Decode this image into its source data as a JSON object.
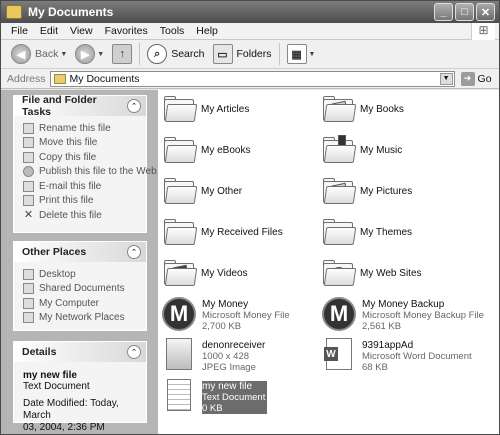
{
  "window": {
    "title": "My Documents"
  },
  "title_buttons": {
    "minimize": "_",
    "maximize": "□",
    "close": "✕"
  },
  "menubar": {
    "items": [
      "File",
      "Edit",
      "View",
      "Favorites",
      "Tools",
      "Help"
    ]
  },
  "toolbar": {
    "back": "Back",
    "search": "Search",
    "folders": "Folders"
  },
  "address": {
    "label": "Address",
    "value": "My Documents",
    "go": "Go"
  },
  "file_tasks": {
    "title": "File and Folder Tasks",
    "items": [
      {
        "label": "Rename this file",
        "icon": "rename-icon"
      },
      {
        "label": "Move this file",
        "icon": "move-icon"
      },
      {
        "label": "Copy this file",
        "icon": "copy-icon"
      },
      {
        "label": "Publish this file to the Web",
        "icon": "globe-icon"
      },
      {
        "label": "E-mail this file",
        "icon": "email-icon"
      },
      {
        "label": "Print this file",
        "icon": "print-icon"
      },
      {
        "label": "Delete this file",
        "icon": "delete-icon"
      }
    ]
  },
  "other_places": {
    "title": "Other Places",
    "items": [
      {
        "label": "Desktop",
        "icon": "desktop-icon"
      },
      {
        "label": "Shared Documents",
        "icon": "folder-icon"
      },
      {
        "label": "My Computer",
        "icon": "computer-icon"
      },
      {
        "label": "My Network Places",
        "icon": "network-icon"
      }
    ]
  },
  "details": {
    "title": "Details",
    "name": "my new file",
    "type": "Text Document",
    "modified_line1": "Date Modified: Today, March",
    "modified_line2": "03, 2004, 2:36 PM"
  },
  "folders": [
    {
      "label": "My Articles",
      "icon": "folder-icon"
    },
    {
      "label": "My Books",
      "icon": "books-folder-icon"
    },
    {
      "label": "My eBooks",
      "icon": "folder-icon"
    },
    {
      "label": "My Music",
      "icon": "music-folder-icon"
    },
    {
      "label": "My Other",
      "icon": "folder-icon"
    },
    {
      "label": "My Pictures",
      "icon": "pictures-folder-icon"
    },
    {
      "label": "My Received Files",
      "icon": "folder-icon"
    },
    {
      "label": "My Themes",
      "icon": "folder-icon"
    },
    {
      "label": "My Videos",
      "icon": "videos-folder-icon"
    },
    {
      "label": "My Web Sites",
      "icon": "websites-folder-icon"
    }
  ],
  "files": [
    {
      "name": "My Money",
      "type": "Microsoft Money File",
      "size": "2,700 KB"
    },
    {
      "name": "My Money Backup",
      "type": "Microsoft Money Backup File",
      "size": "2,561 KB"
    },
    {
      "name": "denonreceiver",
      "type": "1000 x 428",
      "size": "JPEG Image"
    },
    {
      "name": "9391appAd",
      "type": "Microsoft Word Document",
      "size": "68 KB"
    },
    {
      "name": "my new file",
      "type": "Text Document",
      "size": "0 KB"
    }
  ]
}
